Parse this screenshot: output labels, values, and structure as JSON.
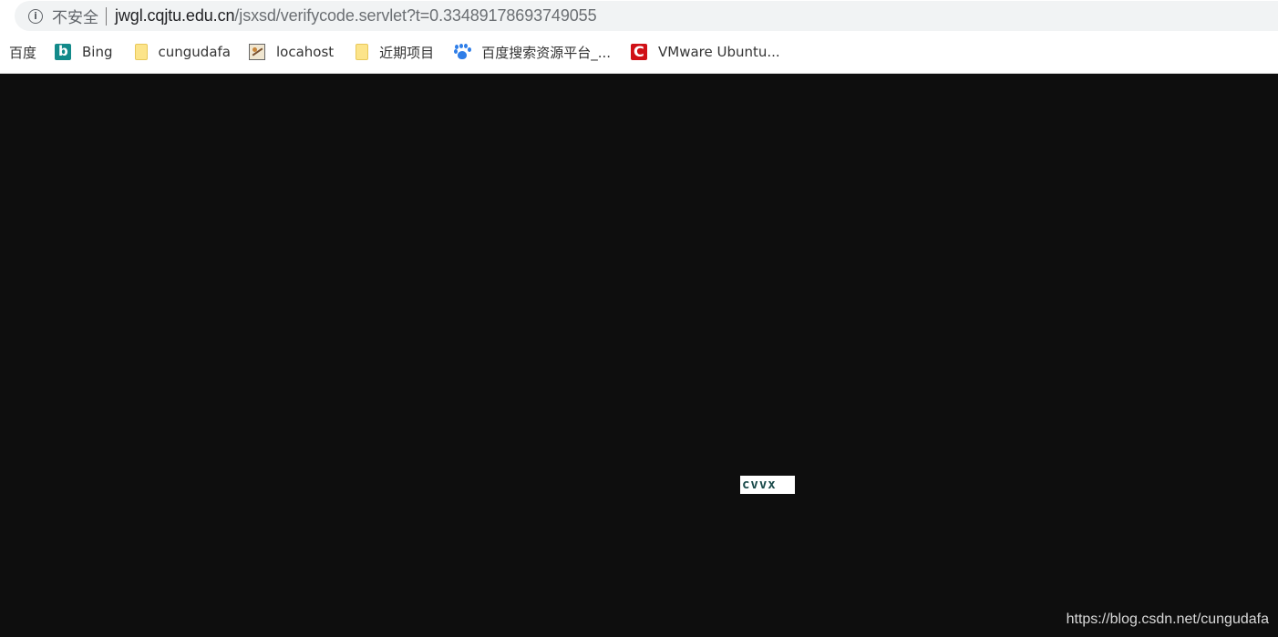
{
  "address_bar": {
    "security_label": "不安全",
    "url_host": "jwgl.cqjtu.edu.cn",
    "url_path": "/jsxsd/verifycode.servlet?t=0.33489178693749055"
  },
  "bookmarks": [
    {
      "label": "百度",
      "icon": "none"
    },
    {
      "label": "Bing",
      "icon": "bing-icon"
    },
    {
      "label": "cungudafa",
      "icon": "folder-icon"
    },
    {
      "label": "locahost",
      "icon": "localhost-icon"
    },
    {
      "label": "近期项目",
      "icon": "folder-icon"
    },
    {
      "label": "百度搜索资源平台_...",
      "icon": "baidu-paw-icon"
    },
    {
      "label": "VMware Ubuntu...",
      "icon": "csdn-icon"
    }
  ],
  "captcha": {
    "text": "cvvx"
  },
  "watermark": "https://blog.csdn.net/cungudafa",
  "colors": {
    "page_background": "#0e0e0e",
    "omnibox_background": "#f1f3f4",
    "bing_teal": "#138a8a",
    "csdn_red": "#d01016",
    "baidu_blue": "#2f7ee8",
    "folder_yellow": "#fce48a"
  }
}
